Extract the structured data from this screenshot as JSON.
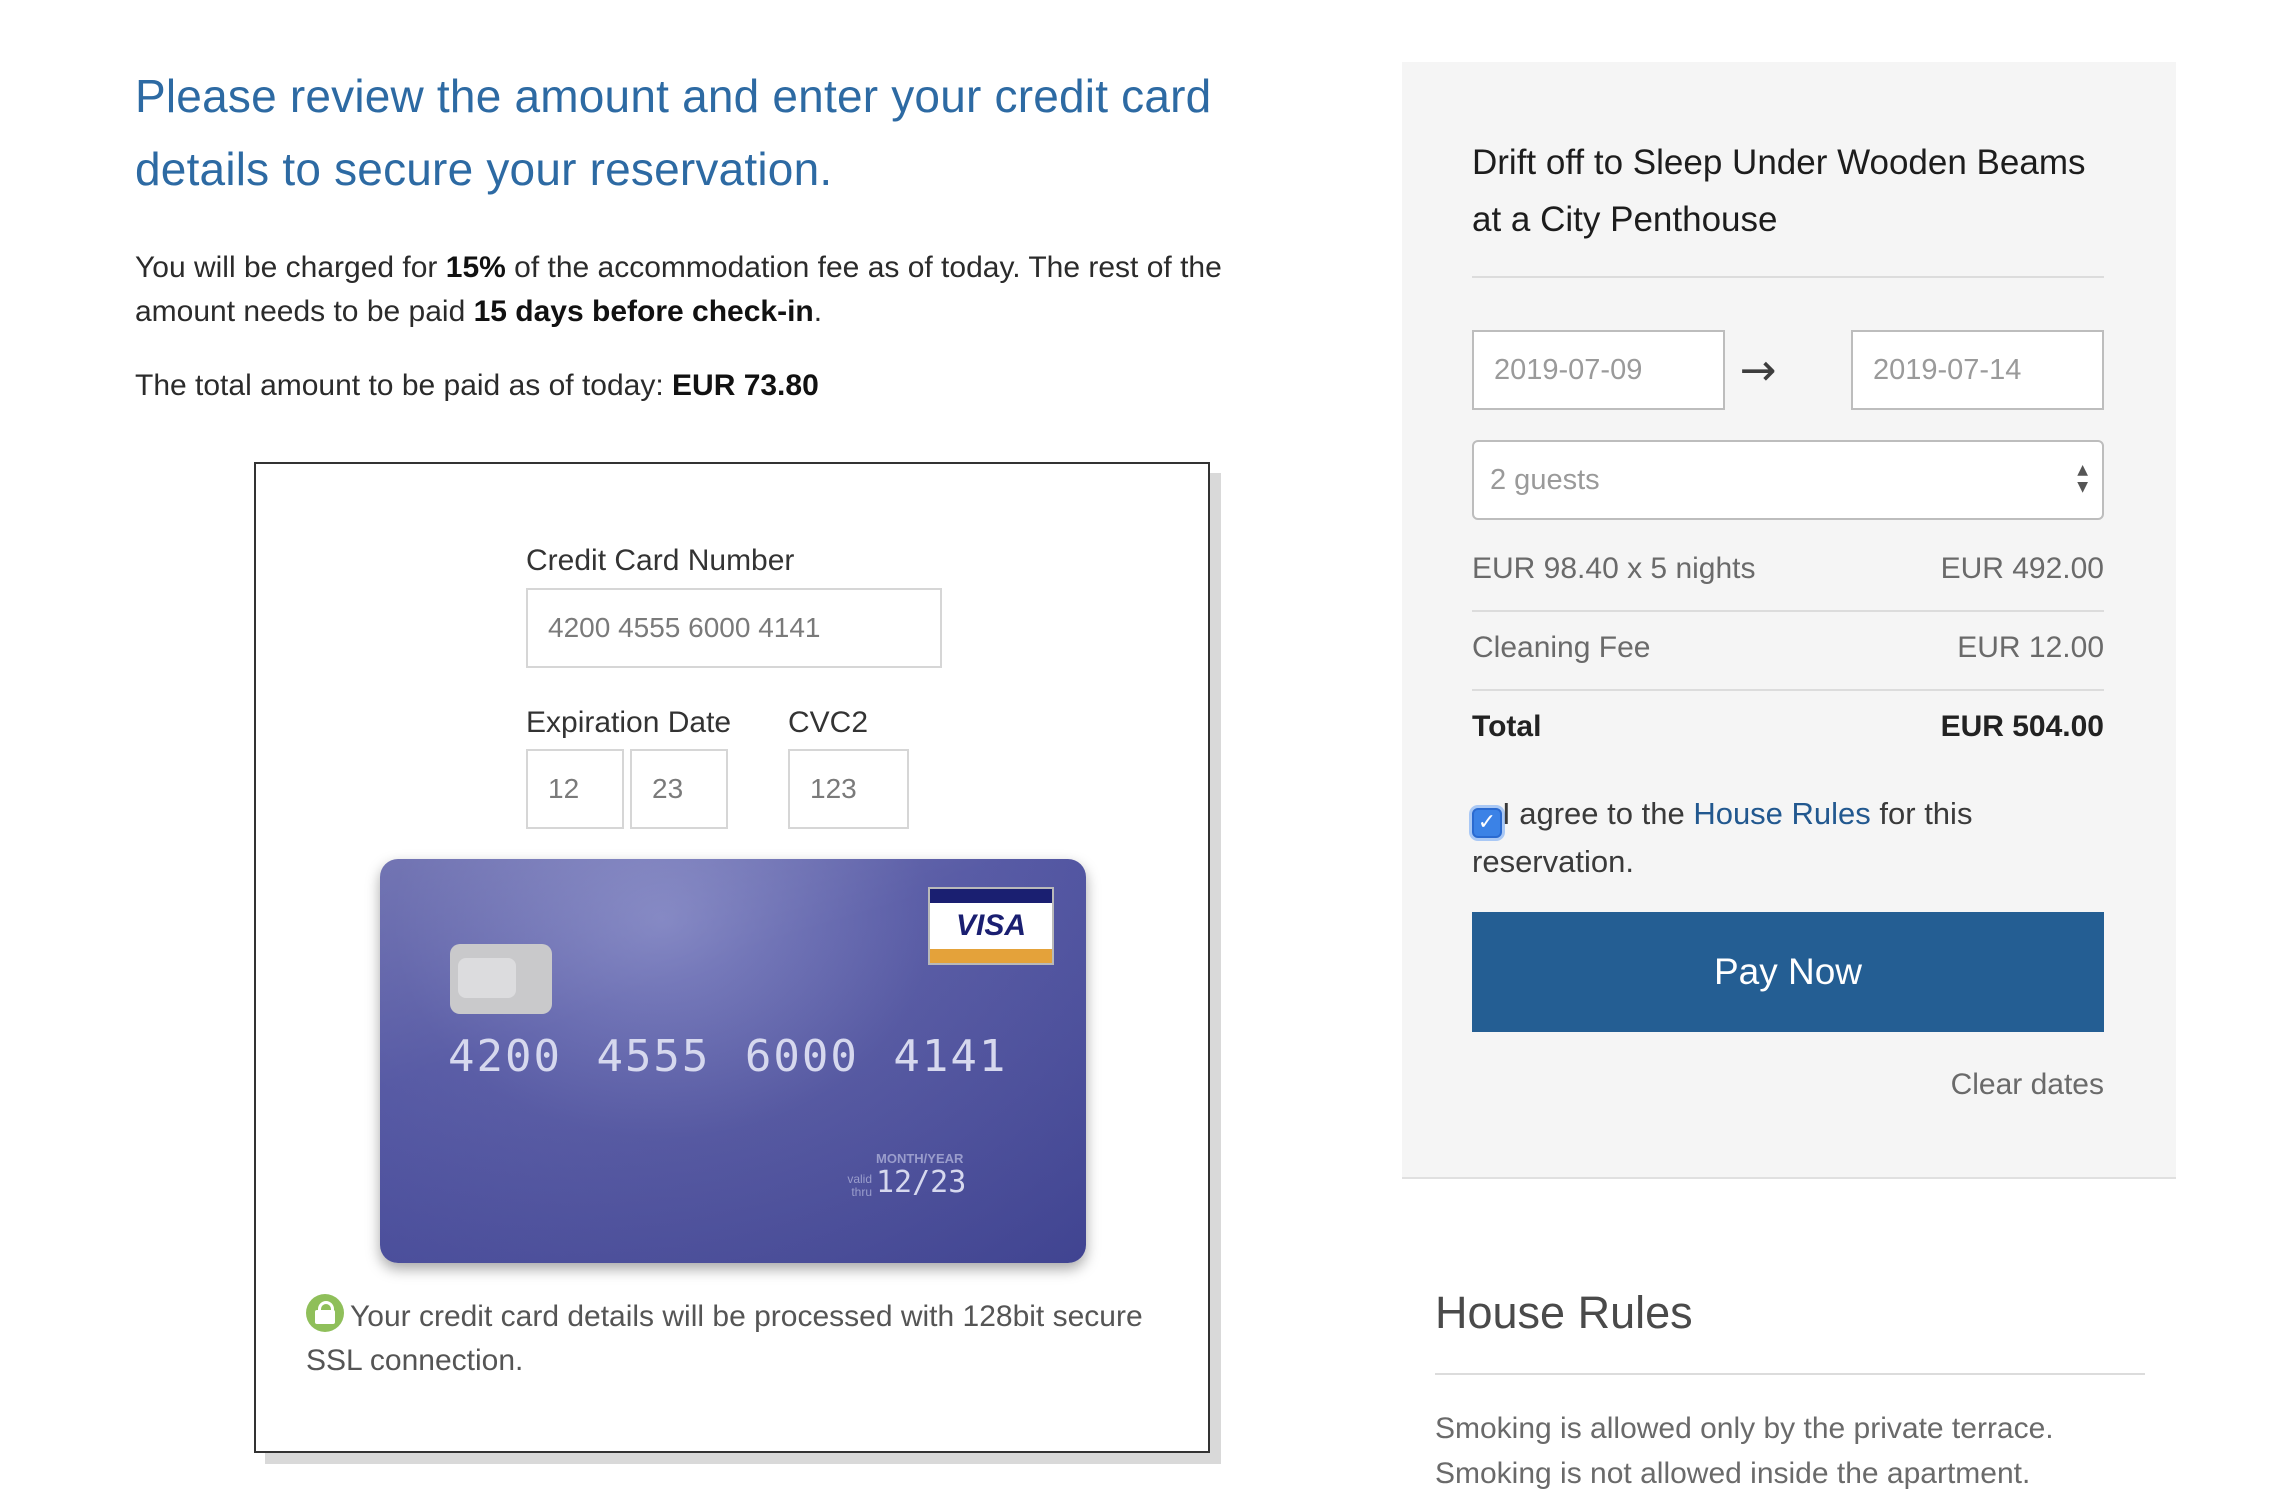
{
  "payment": {
    "headline": "Please review the amount and enter your credit card details to secure your reservation.",
    "charge_prefix": "You will be charged for ",
    "charge_percent": "15%",
    "charge_middle": " of the accommodation fee as of today. The rest of the amount needs to be paid ",
    "charge_deadline": "15 days before check-in",
    "charge_suffix": ".",
    "total_prefix": "The total amount to be paid as of today: ",
    "total_amount": "EUR 73.80"
  },
  "form": {
    "card_number_label": "Credit Card Number",
    "card_number_value": "4200 4555 6000 4141",
    "expiration_label": "Expiration Date",
    "exp_month": "12",
    "exp_year": "23",
    "cvc_label": "CVC2",
    "cvc_value": "123",
    "ssl_note": "Your credit card details will be processed with 128bit secure SSL connection."
  },
  "card_preview": {
    "brand": "VISA",
    "number": "4200 4555 6000 4141",
    "month_year_label": "MONTH/YEAR",
    "valid_thru": "valid thru",
    "expiry": "12/23",
    "colors": {
      "card": "#5457a3",
      "visa_blue": "#1a1f71",
      "visa_gold": "#e4a23a"
    }
  },
  "sidebar": {
    "listing_title": "Drift off to Sleep Under Wooden Beams at a City Penthouse",
    "check_in": "2019-07-09",
    "check_out": "2019-07-14",
    "arrow_icon": "arrow-right-icon",
    "guests": "2 guests",
    "lines": [
      {
        "label": "EUR 98.40 x 5 nights",
        "amount": "EUR 492.00"
      },
      {
        "label": "Cleaning Fee",
        "amount": "EUR 12.00"
      }
    ],
    "total_label": "Total",
    "total_amount": "EUR 504.00",
    "agree_prefix": "I agree to the ",
    "agree_link": "House Rules",
    "agree_suffix": " for this reservation.",
    "agree_checked": true,
    "pay_button": "Pay Now",
    "clear_dates": "Clear dates",
    "colors": {
      "button": "#245e93",
      "link": "#22588f",
      "accent": "#2d6aa3"
    }
  },
  "house_rules": {
    "title": "House Rules",
    "text": "Smoking is allowed only by the private terrace. Smoking is not allowed inside the apartment."
  }
}
